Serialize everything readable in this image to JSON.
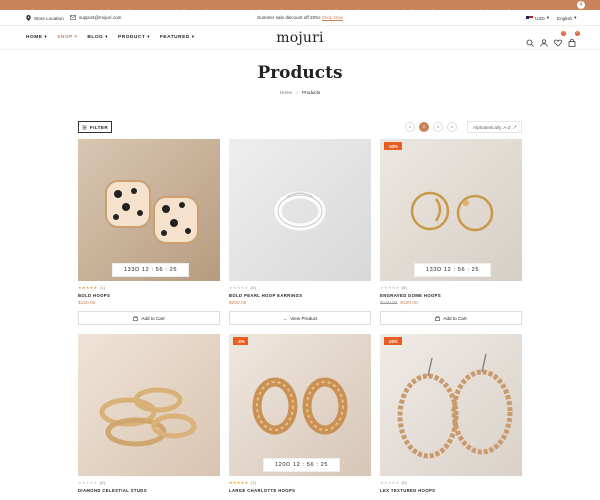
{
  "marquee": {
    "items": [
      {
        "text": "Summer sale discount",
        "off": "off 35%"
      },
      {
        "text": "Summer sale discount",
        "off": "off 35%"
      },
      {
        "text": "Summer sale discount",
        "off": "off 35%"
      },
      {
        "text": "Summer sale discount",
        "off": "off 35%"
      },
      {
        "text": "Summer sale discount",
        "off": "off 35%"
      },
      {
        "text": "Summer sale discount",
        "off": "off 35%"
      },
      {
        "text": "Summer sale discount",
        "off": "off 35%"
      },
      {
        "text": "Sum",
        "off": ""
      }
    ],
    "bubble": "4"
  },
  "infobar": {
    "store_location": "Store Location",
    "email": "support@mojuri.com",
    "promo_text": "Summer sale discount off 20%!",
    "promo_link": "Shop Now",
    "currency": "USD",
    "language": "English"
  },
  "nav": {
    "items": [
      "HOME",
      "SHOP",
      "BLOG",
      "PRODUCT",
      "FEATURED"
    ],
    "active": "SHOP"
  },
  "logo": "mojuri",
  "header_icons": {
    "wishlist_count": "0",
    "cart_count": "0"
  },
  "page": {
    "title": "Products",
    "breadcrumb_home": "Home",
    "breadcrumb_current": "Products"
  },
  "toolbar": {
    "filter_label": "FILTER",
    "views": [
      "1",
      "2",
      "3",
      "4"
    ],
    "active_view": "2",
    "sort_label": "Alphabetically, A-Z"
  },
  "products": [
    {
      "name": "BOLD HOOPS",
      "price": "$150.00",
      "old_price": "",
      "rating": 5,
      "reviews": "(1)",
      "sale": "",
      "countdown": "133D 12 : 56 : 25",
      "button": "Add to Cart"
    },
    {
      "name": "BOLD PEARL HOOP EARRINGS",
      "price": "$200.00",
      "old_price": "",
      "rating": 0,
      "reviews": "(0)",
      "sale": "",
      "countdown": "",
      "button": "View Product"
    },
    {
      "name": "ENGRAVED DOME HOOPS",
      "price": "$100.00",
      "old_price": "$150.00",
      "rating": 0,
      "reviews": "(0)",
      "sale": "-33%",
      "countdown": "133D 12 : 56 : 25",
      "button": "Add to Cart"
    },
    {
      "name": "DIAMOND CELESTIAL STUDS",
      "price": "",
      "old_price": "",
      "rating": 0,
      "reviews": "(0)",
      "sale": "",
      "countdown": "",
      "button": ""
    },
    {
      "name": "LARGE CHARLOTTE HOOPS",
      "price": "",
      "old_price": "",
      "rating": 5,
      "reviews": "(1)",
      "sale": "-3%",
      "countdown": "120D 12 : 56 : 25",
      "button": ""
    },
    {
      "name": "LEX TEXTURED HOOPS",
      "price": "",
      "old_price": "",
      "rating": 0,
      "reviews": "(0)",
      "sale": "-20%",
      "countdown": "",
      "button": ""
    }
  ],
  "colors": {
    "accent": "#c9835a",
    "sale": "#e85d20"
  }
}
